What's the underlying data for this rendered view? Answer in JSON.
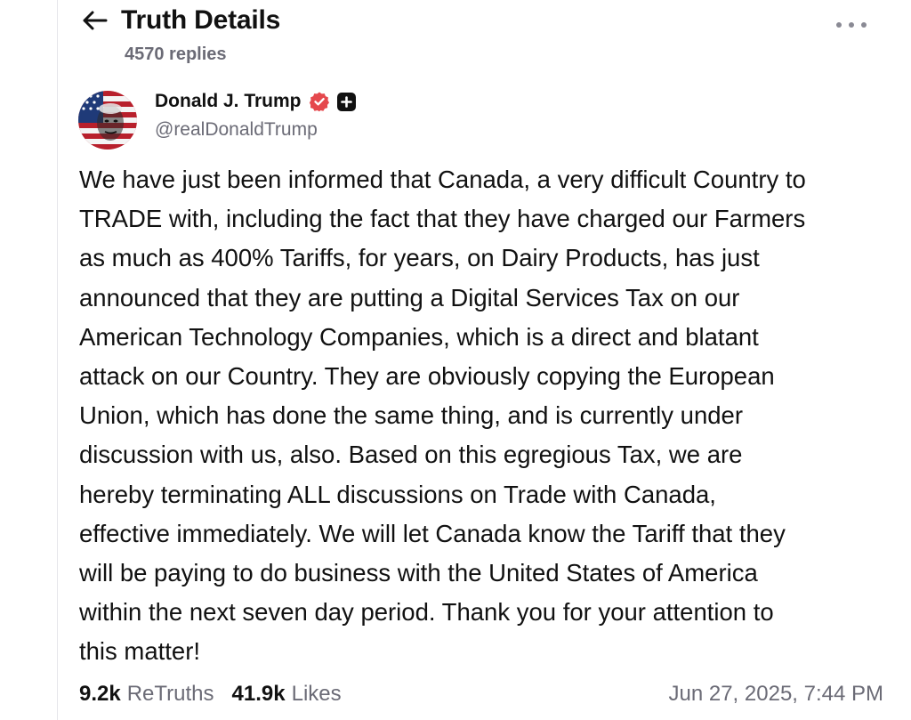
{
  "header": {
    "title": "Truth Details",
    "replies": "4570 replies"
  },
  "icons": {
    "back": "arrow-left-icon",
    "more": "more-horizontal-icon",
    "verified": "verified-badge-icon",
    "plus": "plus-badge-icon"
  },
  "post": {
    "author_name": "Donald J. Trump",
    "handle": "@realDonaldTrump",
    "text": "We have just been informed that Canada, a very difficult Country to\nTRADE with, including the fact that they have charged our Farmers\nas much as 400% Tariffs, for years, on Dairy Products, has just\nannounced that they are putting a Digital Services Tax on our\nAmerican Technology Companies, which is a direct and blatant\nattack on our Country. They are obviously copying the European\nUnion, which has done the same thing, and is currently under\ndiscussion with us, also. Based on this egregious Tax, we are\nhereby terminating ALL discussions on Trade with Canada,\neffective immediately. We will let Canada know the Tariff that they\nwill be paying to do business with the United States of America\nwithin the next seven day period. Thank you for your attention to\nthis matter!",
    "retruths_count": "9.2k",
    "retruths_label": "ReTruths",
    "likes_count": "41.9k",
    "likes_label": "Likes",
    "timestamp": "Jun 27, 2025, 7:44 PM"
  },
  "colors": {
    "text": "#111111",
    "muted": "#6b6b76",
    "verified": "#e5484d",
    "border": "#e6e6ea"
  }
}
